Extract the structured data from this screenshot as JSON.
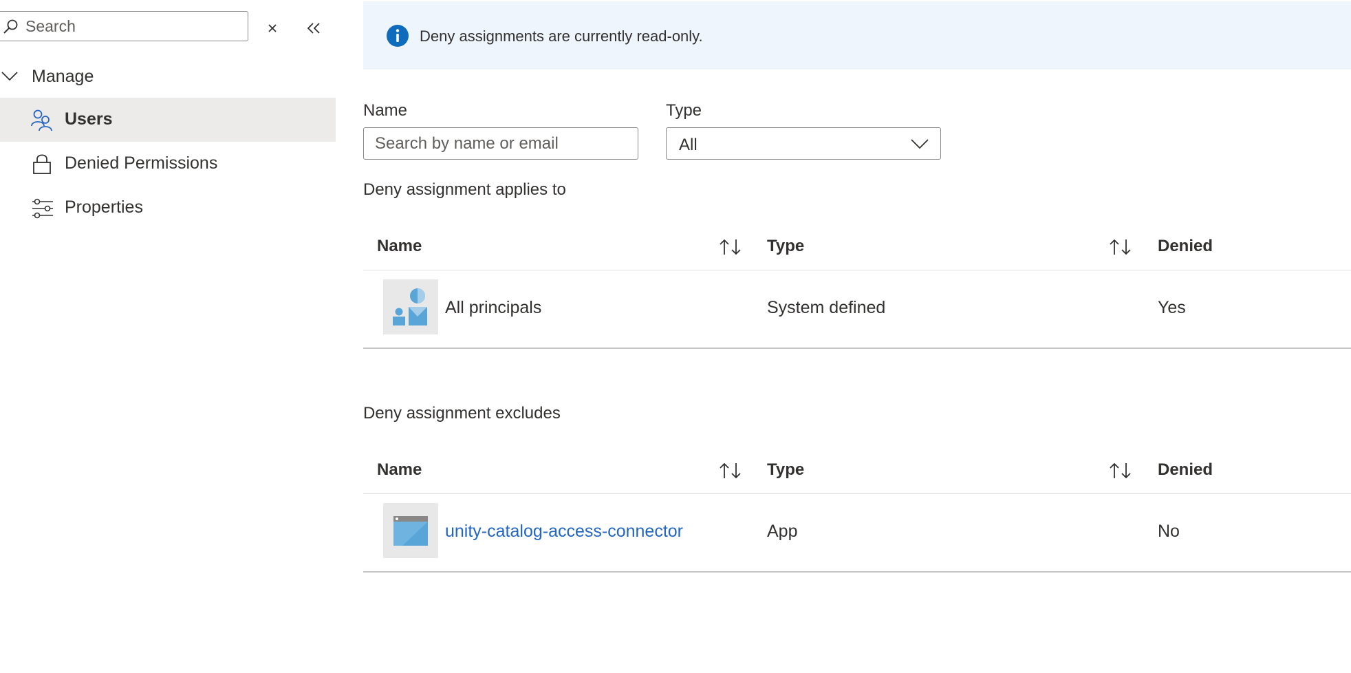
{
  "sidebar": {
    "search": {
      "placeholder": "Search",
      "value": ""
    },
    "manage_label": "Manage",
    "items": [
      {
        "label": "Users",
        "icon": "users-icon",
        "active": true
      },
      {
        "label": "Denied Permissions",
        "icon": "lock-icon",
        "active": false
      },
      {
        "label": "Properties",
        "icon": "sliders-icon",
        "active": false
      }
    ]
  },
  "banner": {
    "text": "Deny assignments are currently read-only."
  },
  "filters": {
    "name_label": "Name",
    "name_placeholder": "Search by name or email",
    "type_label": "Type",
    "type_value": "All"
  },
  "applies_to": {
    "title": "Deny assignment applies to",
    "columns": [
      "Name",
      "Type",
      "Denied"
    ],
    "rows": [
      {
        "name": "All principals",
        "type": "System defined",
        "denied": "Yes",
        "icon": "principals-icon"
      }
    ]
  },
  "excludes": {
    "title": "Deny assignment excludes",
    "columns": [
      "Name",
      "Type",
      "Denied"
    ],
    "rows": [
      {
        "name": "unity-catalog-access-connector",
        "type": "App",
        "denied": "No",
        "icon": "app-icon"
      }
    ]
  },
  "colors": {
    "accent": "#2266c4",
    "banner_bg": "#eff5fd",
    "active_bg": "#edebe9",
    "info": "#0f6cbd"
  }
}
